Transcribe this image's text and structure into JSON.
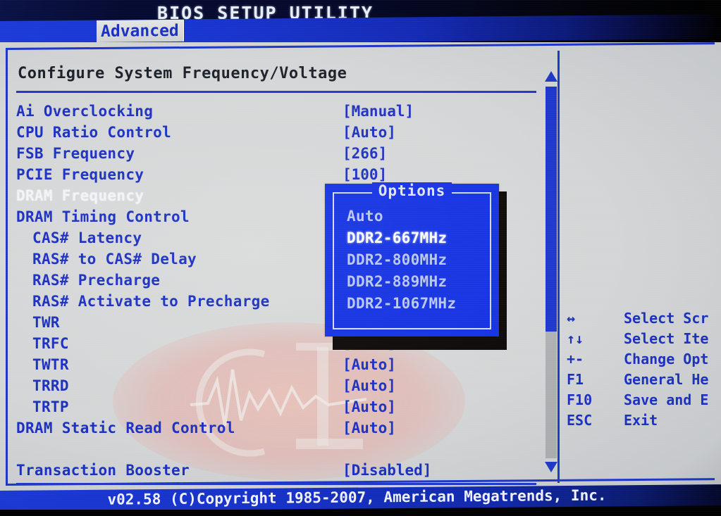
{
  "header": {
    "title": "BIOS SETUP UTILITY",
    "active_tab": "Advanced"
  },
  "panel": {
    "title": "Configure System Frequency/Voltage"
  },
  "menu": {
    "rows": [
      {
        "label": "Ai Overclocking",
        "value": "[Manual]",
        "indent": false,
        "selected": false
      },
      {
        "label": "CPU Ratio Control",
        "value": "[Auto]",
        "indent": false,
        "selected": false
      },
      {
        "label": "FSB Frequency",
        "value": "[266]",
        "indent": false,
        "selected": false
      },
      {
        "label": "PCIE Frequency",
        "value": "[100]",
        "indent": false,
        "selected": false
      },
      {
        "label": "DRAM Frequency",
        "value": "",
        "indent": false,
        "selected": true
      },
      {
        "label": "DRAM Timing Control",
        "value": "",
        "indent": false,
        "selected": false
      },
      {
        "label": "CAS# Latency",
        "value": "",
        "indent": true,
        "selected": false
      },
      {
        "label": "RAS# to CAS# Delay",
        "value": "",
        "indent": true,
        "selected": false
      },
      {
        "label": "RAS# Precharge",
        "value": "",
        "indent": true,
        "selected": false
      },
      {
        "label": "RAS# Activate to Precharge",
        "value": "",
        "indent": true,
        "selected": false
      },
      {
        "label": "TWR",
        "value": "",
        "indent": true,
        "selected": false
      },
      {
        "label": "TRFC",
        "value": "[Auto]",
        "indent": true,
        "selected": false,
        "dim": true
      },
      {
        "label": "TWTR",
        "value": "[Auto]",
        "indent": true,
        "selected": false
      },
      {
        "label": "TRRD",
        "value": "[Auto]",
        "indent": true,
        "selected": false
      },
      {
        "label": "TRTP",
        "value": "[Auto]",
        "indent": true,
        "selected": false
      },
      {
        "label": "DRAM Static Read Control",
        "value": "[Auto]",
        "indent": false,
        "selected": false
      },
      {
        "label": "",
        "value": "",
        "indent": false,
        "selected": false
      },
      {
        "label": "Transaction Booster",
        "value": "[Disabled]",
        "indent": false,
        "selected": false
      }
    ]
  },
  "dialog": {
    "title": "Options",
    "options": [
      {
        "label": "Auto",
        "selected": false
      },
      {
        "label": "DDR2-667MHz",
        "selected": true
      },
      {
        "label": "DDR2-800MHz",
        "selected": false
      },
      {
        "label": "DDR2-889MHz",
        "selected": false
      },
      {
        "label": "DDR2-1067MHz",
        "selected": false
      }
    ]
  },
  "help": {
    "rows": [
      {
        "key": "↔",
        "text": "Select Scr"
      },
      {
        "key": "↑↓",
        "text": "Select Ite"
      },
      {
        "key": "+-",
        "text": "Change Opt"
      },
      {
        "key": "F1",
        "text": "General He"
      },
      {
        "key": "F10",
        "text": "Save and E"
      },
      {
        "key": "ESC",
        "text": "Exit"
      }
    ]
  },
  "footer": {
    "text": "v02.58 (C)Copyright 1985-2007, American Megatrends, Inc."
  },
  "colors": {
    "accent_blue": "#1c30c0",
    "header_blue": "#1733cf",
    "dialog_blue": "#1331e2",
    "plate_gray": "#d3d5d6",
    "selected_white": "#ffffff",
    "watermark_pink": "#e8a79e"
  }
}
